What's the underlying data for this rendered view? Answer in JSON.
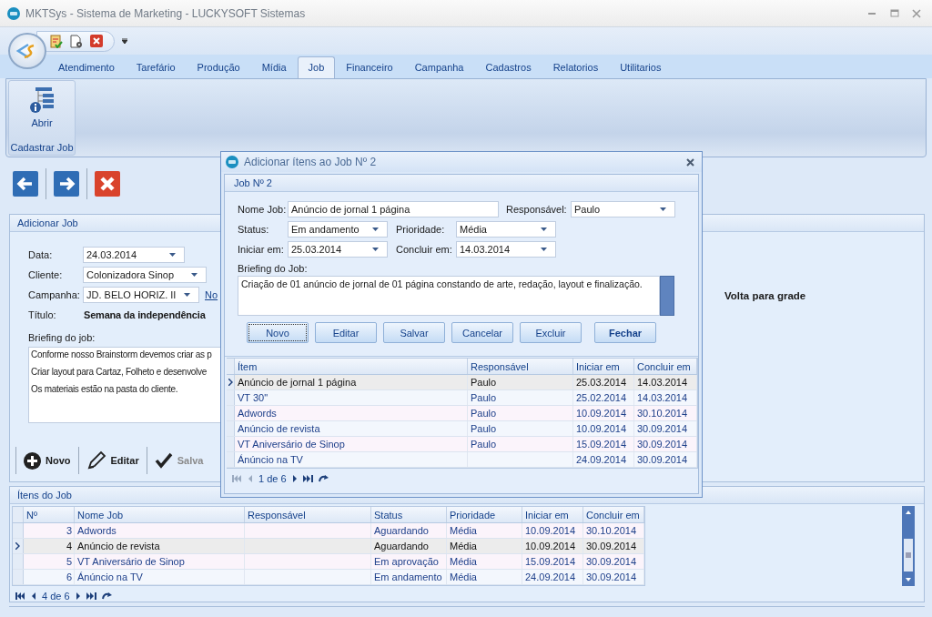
{
  "window": {
    "title": "MKTSys - Sistema de Marketing - LUCKYSOFT Sistemas"
  },
  "ribbon": {
    "tabs": [
      {
        "label": "Atendimento",
        "selected": false
      },
      {
        "label": "Tarefário",
        "selected": false
      },
      {
        "label": "Produção",
        "selected": false
      },
      {
        "label": "Mídia",
        "selected": false
      },
      {
        "label": "Job",
        "selected": true
      },
      {
        "label": "Financeiro",
        "selected": false
      },
      {
        "label": "Campanha",
        "selected": false
      },
      {
        "label": "Cadastros",
        "selected": false
      },
      {
        "label": "Relatorios",
        "selected": false
      },
      {
        "label": "Utilitarios",
        "selected": false
      }
    ],
    "group": {
      "label": "Cadastrar Job",
      "button": "Abrir"
    }
  },
  "add_job_panel": {
    "title": "Adicionar Job",
    "fields": [
      {
        "label": "Data:",
        "value": "24.03.2014",
        "kind": "dropdown"
      },
      {
        "label": "Cliente:",
        "value": "Colonizadora Sinop",
        "kind": "dropdown"
      },
      {
        "label": "Campanha:",
        "value": "JD. BELO HORIZ. II",
        "kind": "dropdown",
        "link": "No"
      },
      {
        "label": "Título:",
        "value": "Semana da independência",
        "kind": "title"
      }
    ],
    "briefing_label": "Briefing do job:",
    "briefing_lines": [
      "Conforme nosso Brainstorm devemos criar as p",
      "Criar layout para Cartaz, Folheto e desenvolve",
      "Os materiais estão na pasta do cliente."
    ],
    "side_text": "Volta para grade",
    "toolbar": [
      {
        "label": "Novo",
        "kind": "add",
        "disabled": false
      },
      {
        "label": "Editar",
        "kind": "edit",
        "disabled": false
      },
      {
        "label": "Salva",
        "kind": "save",
        "disabled": true
      }
    ]
  },
  "items_panel": {
    "title": "Ítens do Job",
    "table": {
      "columns": [
        "Nº",
        "Nome Job",
        "Responsável",
        "Status",
        "Prioridade",
        "Iniciar em",
        "Concluir em"
      ],
      "rows": [
        {
          "cells": [
            "3",
            "Adwords",
            "",
            "Aguardando",
            "Média",
            "10.09.2014",
            "30.10.2014"
          ],
          "selected": false
        },
        {
          "cells": [
            "4",
            "Anúncio de revista",
            "",
            "Aguardando",
            "Média",
            "10.09.2014",
            "30.09.2014"
          ],
          "selected": true
        },
        {
          "cells": [
            "5",
            "VT Aniversário de Sinop",
            "",
            "Em aprovação",
            "Média",
            "15.09.2014",
            "30.09.2014"
          ],
          "selected": false
        },
        {
          "cells": [
            "6",
            "Ánúncio na TV",
            "",
            "Em andamento",
            "Média",
            "24.09.2014",
            "30.09.2014"
          ],
          "selected": false
        }
      ]
    },
    "pager": "4 de 6"
  },
  "dialog": {
    "title": "Adicionar ítens ao Job Nº 2",
    "group": "Job Nº 2",
    "field_rows": [
      [
        {
          "label": "Nome Job:",
          "value": "Anúncio de jornal 1 página",
          "kind": "text"
        },
        {
          "label": "Responsável:",
          "value": "Paulo",
          "kind": "dropdown"
        }
      ],
      [
        {
          "label": "Status:",
          "value": "Em andamento",
          "kind": "dropdown"
        },
        {
          "label": "Prioridade:",
          "value": "Média",
          "kind": "dropdown"
        }
      ],
      [
        {
          "label": "Iniciar em:",
          "value": "25.03.2014",
          "kind": "dropdown"
        },
        {
          "label": "Concluir em:",
          "value": "14.03.2014",
          "kind": "dropdown"
        }
      ]
    ],
    "briefing_label": "Briefing do Job:",
    "briefing": "Criação de 01 anúncio de jornal de 01 página constando de arte, redação, layout e finalização.",
    "buttons": [
      {
        "label": "Novo",
        "focused": true,
        "default": false
      },
      {
        "label": "Editar",
        "focused": false,
        "default": false
      },
      {
        "label": "Salvar",
        "focused": false,
        "default": false
      },
      {
        "label": "Cancelar",
        "focused": false,
        "default": false
      },
      {
        "label": "Excluir",
        "focused": false,
        "default": false
      },
      {
        "label": "Fechar",
        "focused": false,
        "default": true
      }
    ],
    "table": {
      "columns": [
        "Ítem",
        "Responsável",
        "Iniciar em",
        "Concluir em"
      ],
      "rows": [
        {
          "cells": [
            "Anúncio de jornal 1 página",
            "Paulo",
            "25.03.2014",
            "14.03.2014"
          ],
          "selected": true
        },
        {
          "cells": [
            "VT 30\"",
            "Paulo",
            "25.02.2014",
            "14.03.2014"
          ],
          "selected": false
        },
        {
          "cells": [
            "Adwords",
            "Paulo",
            "10.09.2014",
            "30.10.2014"
          ],
          "selected": false
        },
        {
          "cells": [
            "Anúncio de revista",
            "Paulo",
            "10.09.2014",
            "30.09.2014"
          ],
          "selected": false
        },
        {
          "cells": [
            "VT Aniversário de Sinop",
            "Paulo",
            "15.09.2014",
            "30.09.2014"
          ],
          "selected": false
        },
        {
          "cells": [
            "Ánúncio na TV",
            "",
            "24.09.2014",
            "30.09.2014"
          ],
          "selected": false
        }
      ]
    },
    "pager": "1 de 6"
  }
}
